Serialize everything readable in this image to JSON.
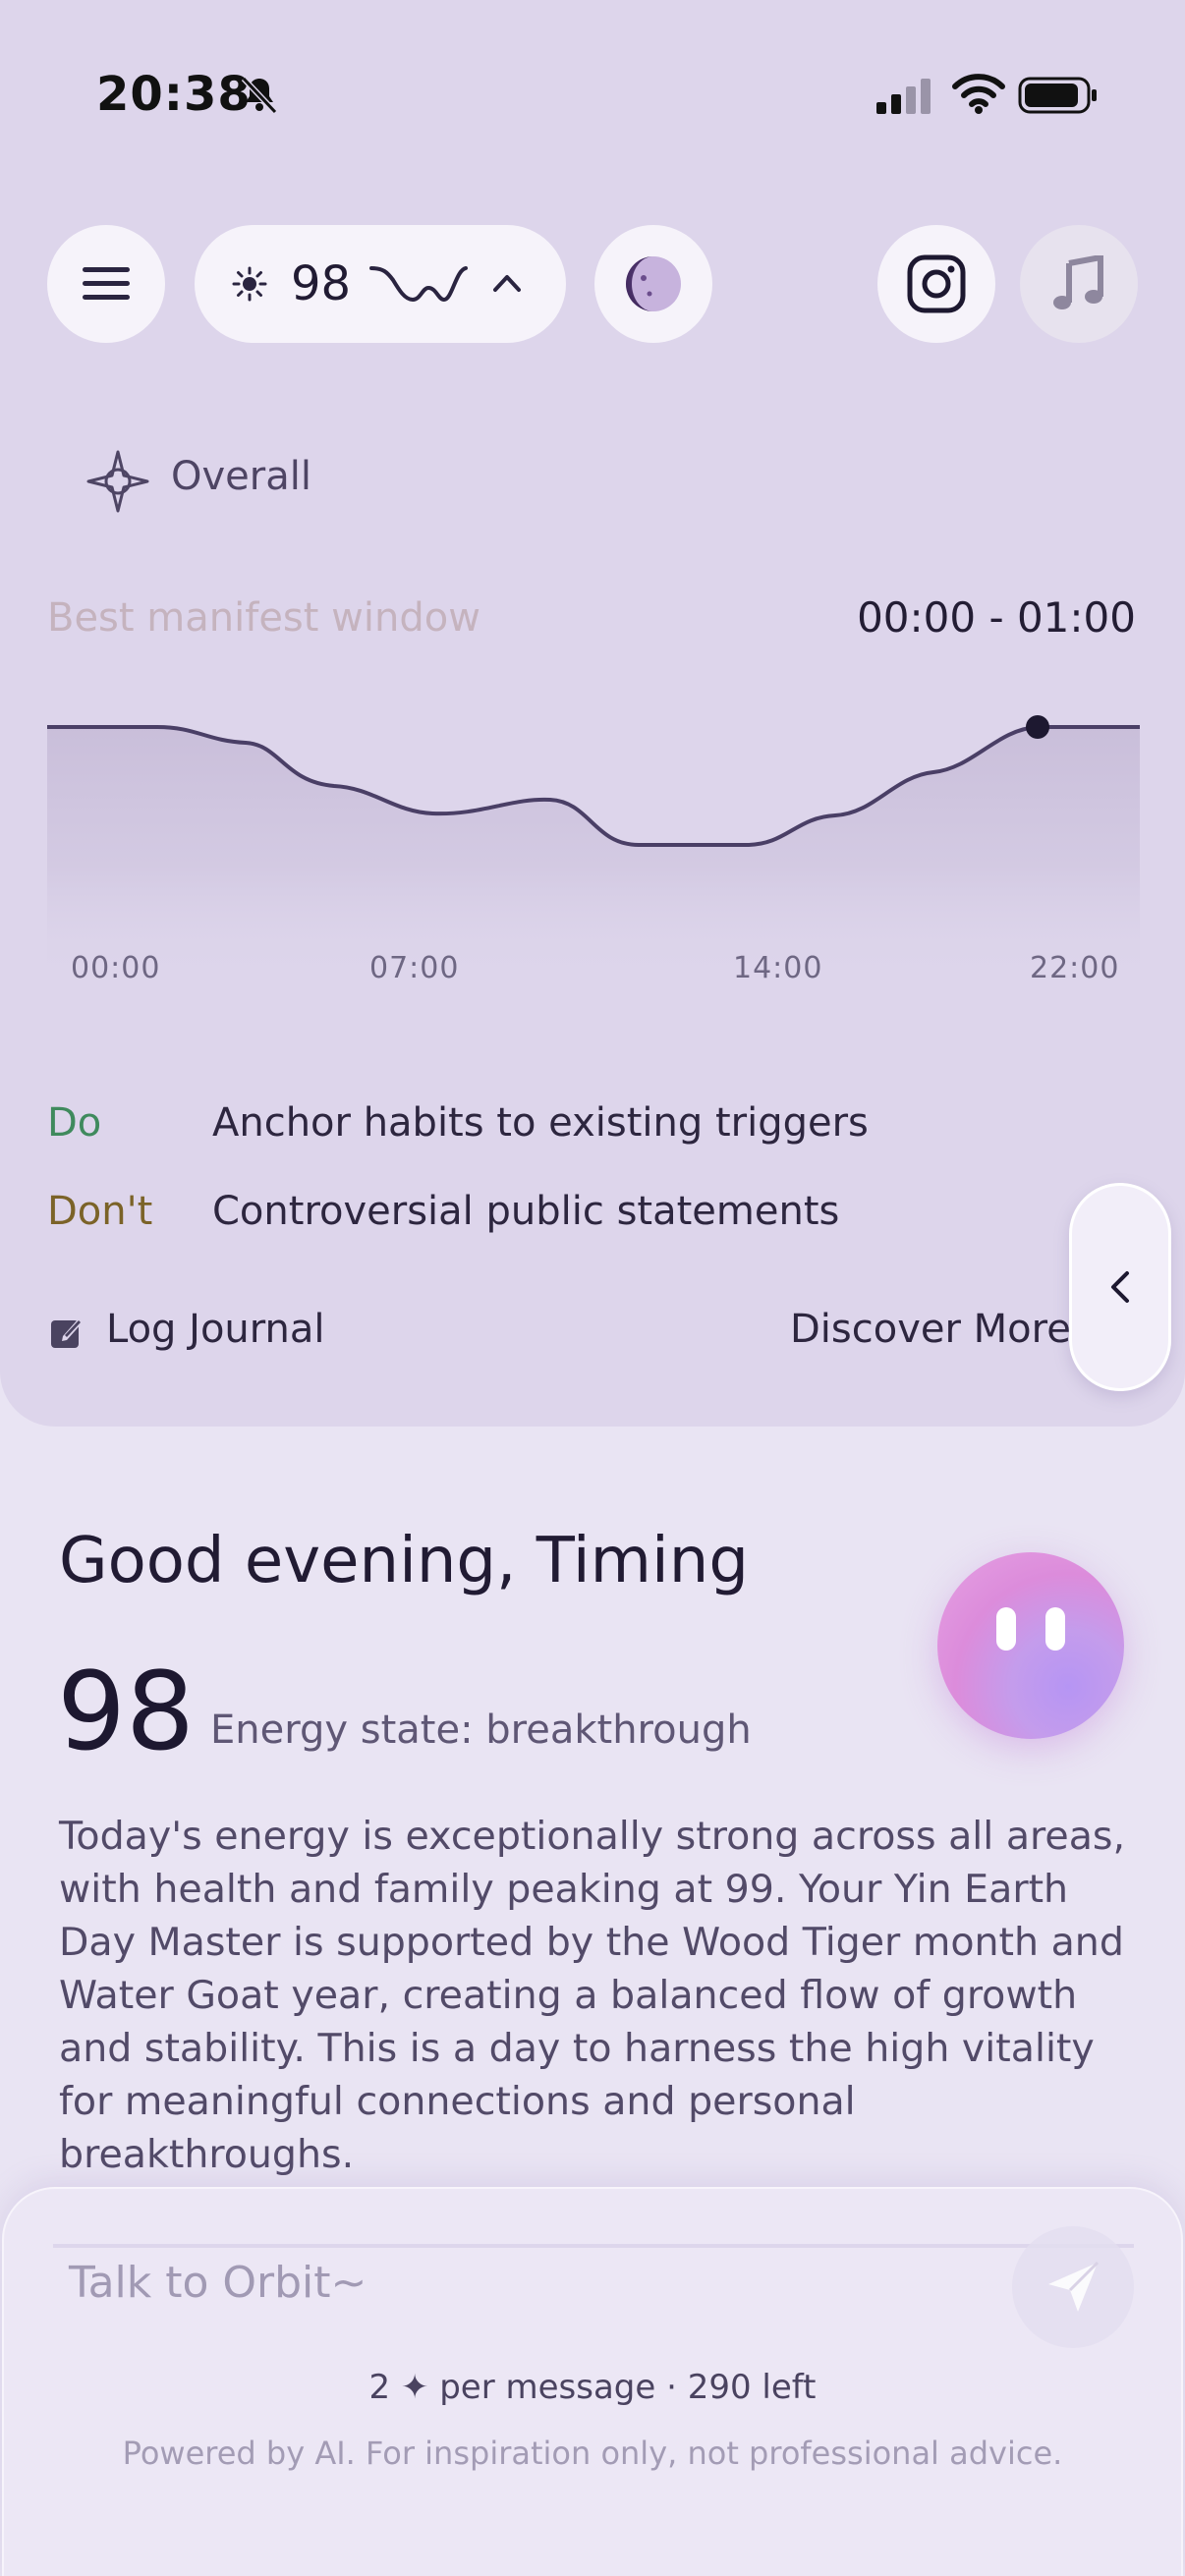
{
  "status_bar": {
    "time": "20:38",
    "icons": [
      "bell-off-icon",
      "signal-icon",
      "wifi-icon",
      "battery-icon"
    ]
  },
  "toolbar": {
    "menu_icon": "hamburger-menu-icon",
    "energy_score": "98",
    "energy_icons": [
      "sun-icon",
      "wave-icon",
      "chevron-up-icon"
    ],
    "moon_icon": "moon-phase-icon",
    "instagram_icon": "instagram-icon",
    "music_icon": "music-note-icon"
  },
  "overall": {
    "icon": "compass-star-icon",
    "label": "Overall"
  },
  "manifest": {
    "label": "Best manifest window",
    "time_range": "00:00 - 01:00"
  },
  "chart_data": {
    "type": "area",
    "x_ticks": [
      "00:00",
      "07:00",
      "14:00",
      "22:00"
    ],
    "highlight_point_index": 21,
    "colors": {
      "line": "#4a3f66",
      "fill_top": "#c9bfd9",
      "point": "#1d1830"
    }
  },
  "guidance": {
    "do_label": "Do",
    "do_text": "Anchor habits to existing triggers",
    "dont_label": "Don't",
    "dont_text": "Controversial public statements"
  },
  "actions": {
    "journal_icon": "edit-note-icon",
    "journal_label": "Log Journal",
    "discover_label": "Discover More",
    "side_tab_icon": "chevron-left-icon"
  },
  "greeting": {
    "title": "Good evening, Timing",
    "score": "98",
    "state": "Energy state: breakthrough",
    "summary": "Today's energy is exceptionally strong across all areas, with health and family peaking at 99. Your Yin Earth Day Master is supported by the Wood Tiger month and Water Goat year, creating a balanced flow of growth and stability. This is a day to harness the high vitality for meaningful connections and personal breakthroughs."
  },
  "chat": {
    "placeholder": "Talk to Orbit~",
    "send_icon": "send-plane-icon",
    "cost": "2 ✦ per message · 290 left",
    "disclaimer": "Powered by AI. For inspiration only, not professional advice."
  },
  "colors": {
    "card_bg": "#ddd5eb",
    "page_bg": "#e9e4f3",
    "do_green": "#3f8a5d",
    "dont_brown": "#7b6328",
    "muted_label": "#c5b3be"
  }
}
